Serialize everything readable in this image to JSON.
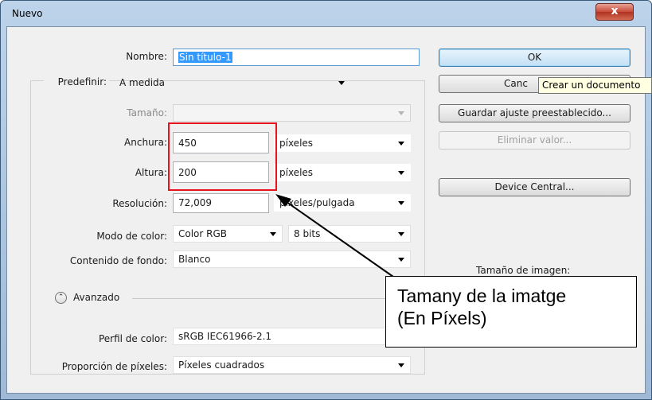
{
  "window": {
    "title": "Nuevo",
    "close_glyph": "x"
  },
  "form": {
    "nombre": {
      "label": "Nombre:",
      "value": "Sin título-1"
    },
    "predefinir": {
      "label": "Predefinir:",
      "value": "A medida"
    },
    "tamano": {
      "label": "Tamaño:",
      "value": ""
    },
    "anchura": {
      "label": "Anchura:",
      "value": "450",
      "unit": "píxeles"
    },
    "altura": {
      "label": "Altura:",
      "value": "200",
      "unit": "píxeles"
    },
    "resolucion": {
      "label": "Resolución:",
      "value": "72,009",
      "unit": "píxeles/pulgada"
    },
    "modo_color": {
      "label": "Modo de color:",
      "value": "Color RGB",
      "bits": "8 bits"
    },
    "contenido_fondo": {
      "label": "Contenido de fondo:",
      "value": "Blanco"
    },
    "avanzado": {
      "label": "Avanzado",
      "glyph": "⌃"
    },
    "perfil_color": {
      "label": "Perfil de color:",
      "value": "sRGB IEC61966-2.1"
    },
    "proporcion_pixeles": {
      "label": "Proporción de píxeles:",
      "value": "Píxeles cuadrados"
    }
  },
  "buttons": {
    "ok": "OK",
    "cancel": "Canc",
    "save_preset": "Guardar ajuste preestablecido...",
    "delete_preset": "Eliminar valor...",
    "device_central": "Device Central..."
  },
  "tooltip": "Crear un documento",
  "image_size_label": "Tamaño de imagen:",
  "annotation": {
    "line1": "Tamany de la imatge",
    "line2": "(En Píxels)"
  },
  "colors": {
    "highlight": "#e8141b",
    "ok_accent": "#3c7fb1",
    "titlebar": "#bcd3ea",
    "close": "#c74a38"
  }
}
